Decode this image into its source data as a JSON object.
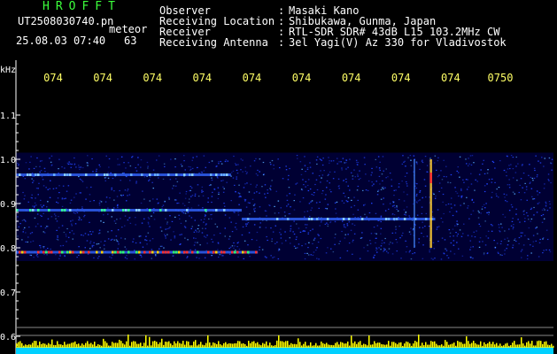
{
  "header": {
    "brand": "HROFFT",
    "file_name": "UT2508030740.pn",
    "file_suffix": "meteor",
    "timestamp": "25.08.03 07:40",
    "count": "63",
    "info": [
      {
        "key": "Observer",
        "value": "Masaki Kano"
      },
      {
        "key": "Receiving Location",
        "value": "Shibukawa, Gunma, Japan"
      },
      {
        "key": "Receiver",
        "value": "RTL-SDR SDR# 43dB L15 103.2MHz CW"
      },
      {
        "key": "Receiving Antenna",
        "value": "3el Yagi(V) Az 330 for Vladivostok"
      }
    ]
  },
  "chart_data": {
    "type": "heatmap",
    "ylabel": "kHz",
    "y_ticks": [
      "1.1",
      "1.0",
      "0.9",
      "0.8",
      "0.7",
      "0.6"
    ],
    "y_tick_values": [
      1.1,
      1.0,
      0.9,
      0.8,
      0.7,
      0.6
    ],
    "x_ticks": [
      "074",
      "074",
      "074",
      "074",
      "074",
      "074",
      "074",
      "074",
      "074",
      "0750"
    ],
    "colors": {
      "axis": "#ffffff",
      "tick_labels": "#ffff66",
      "background": "#000033",
      "noise": "#2244ff",
      "baseline_bars": "#ffff00",
      "baseline_fill": "#00d0ff"
    },
    "echo_lines": [
      {
        "freq_khz": 0.79,
        "strength": "strong",
        "x_start_min": 0,
        "x_end_min": 0.45
      },
      {
        "freq_khz": 0.885,
        "strength": "medium",
        "x_start_min": 0,
        "x_end_min": 0.42
      },
      {
        "freq_khz": 0.865,
        "strength": "weak",
        "x_start_min": 0.42,
        "x_end_min": 0.78
      },
      {
        "freq_khz": 0.965,
        "strength": "weak",
        "x_start_min": 0,
        "x_end_min": 0.4
      }
    ],
    "vertical_bursts": [
      {
        "x_min": 0.74,
        "strength": "weak"
      },
      {
        "x_min": 0.77,
        "strength": "strong"
      }
    ]
  }
}
